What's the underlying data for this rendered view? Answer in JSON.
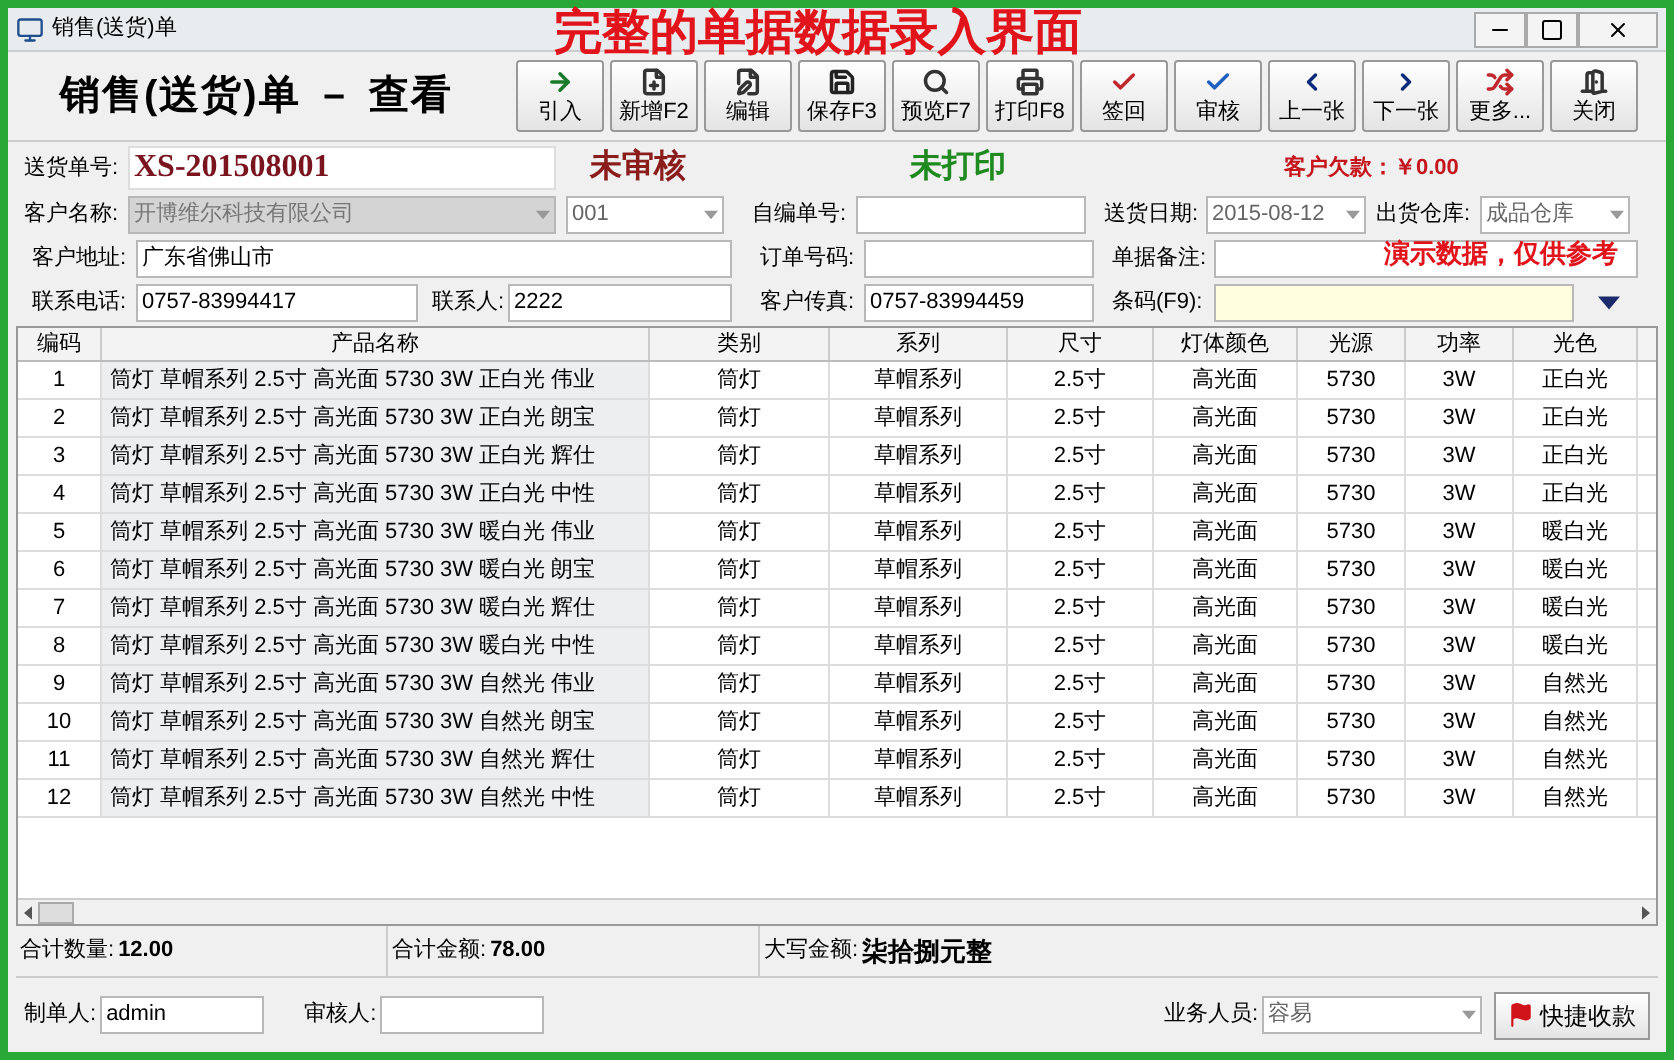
{
  "window": {
    "title": "销售(送货)单"
  },
  "banner": "完整的单据数据录入界面",
  "header": {
    "title": "销售(送货)单 － 查看"
  },
  "toolbar": [
    {
      "label": "引入",
      "kind": "import"
    },
    {
      "label": "新增F2",
      "kind": "new"
    },
    {
      "label": "编辑",
      "kind": "edit"
    },
    {
      "label": "保存F3",
      "kind": "save"
    },
    {
      "label": "预览F7",
      "kind": "preview"
    },
    {
      "label": "打印F8",
      "kind": "print"
    },
    {
      "label": "签回",
      "kind": "signback"
    },
    {
      "label": "审核",
      "kind": "approve"
    },
    {
      "label": "上一张",
      "kind": "prev"
    },
    {
      "label": "下一张",
      "kind": "next"
    },
    {
      "label": "更多...",
      "kind": "more"
    },
    {
      "label": "关闭",
      "kind": "close"
    }
  ],
  "order": {
    "label": "送货单号:",
    "value": "XS-201508001",
    "audit_status": "未审核",
    "print_status": "未打印",
    "debt": "客户欠款：￥0.00"
  },
  "form_rows": [
    [
      {
        "label": "客户名称:",
        "value": "开博维尔科技有限公司",
        "kind": "select",
        "disabled": true
      },
      {
        "value": "001",
        "kind": "select",
        "disabled": false
      },
      {
        "label": "自编单号:",
        "kind": "text"
      },
      {
        "label": "送货日期:",
        "value": "2015-08-12",
        "kind": "select",
        "disabled": false
      },
      {
        "label": "出货仓库:",
        "value": "成品仓库",
        "kind": "select",
        "disabled": false
      }
    ],
    [
      {
        "label": "客户地址:",
        "value": "广东省佛山市",
        "kind": "text"
      },
      {
        "label": "订单号码:",
        "kind": "text"
      },
      {
        "label": "单据备注:",
        "kind": "text"
      }
    ],
    [
      {
        "label": "联系电话:",
        "value": "0757-83994417",
        "kind": "text"
      },
      {
        "label": "联系人:",
        "value": "2222",
        "kind": "text"
      },
      {
        "label": "客户传真:",
        "value": "0757-83994459",
        "kind": "text"
      },
      {
        "label": "条码(F9):",
        "kind": "barcode"
      }
    ]
  ],
  "demo_note": "演示数据，仅供参考",
  "table": {
    "columns": [
      "编码",
      "产品名称",
      "类别",
      "系列",
      "尺寸",
      "灯体颜色",
      "光源",
      "功率",
      "光色"
    ],
    "rows": [
      [
        "1",
        "筒灯 草帽系列 2.5寸 高光面 5730 3W 正白光 伟业",
        "筒灯",
        "草帽系列",
        "2.5寸",
        "高光面",
        "5730",
        "3W",
        "正白光"
      ],
      [
        "2",
        "筒灯 草帽系列 2.5寸 高光面 5730 3W 正白光 朗宝",
        "筒灯",
        "草帽系列",
        "2.5寸",
        "高光面",
        "5730",
        "3W",
        "正白光"
      ],
      [
        "3",
        "筒灯 草帽系列 2.5寸 高光面 5730 3W 正白光 辉仕",
        "筒灯",
        "草帽系列",
        "2.5寸",
        "高光面",
        "5730",
        "3W",
        "正白光"
      ],
      [
        "4",
        "筒灯 草帽系列 2.5寸 高光面 5730 3W 正白光 中性",
        "筒灯",
        "草帽系列",
        "2.5寸",
        "高光面",
        "5730",
        "3W",
        "正白光"
      ],
      [
        "5",
        "筒灯 草帽系列 2.5寸 高光面 5730 3W 暖白光 伟业",
        "筒灯",
        "草帽系列",
        "2.5寸",
        "高光面",
        "5730",
        "3W",
        "暖白光"
      ],
      [
        "6",
        "筒灯 草帽系列 2.5寸 高光面 5730 3W 暖白光 朗宝",
        "筒灯",
        "草帽系列",
        "2.5寸",
        "高光面",
        "5730",
        "3W",
        "暖白光"
      ],
      [
        "7",
        "筒灯 草帽系列 2.5寸 高光面 5730 3W 暖白光 辉仕",
        "筒灯",
        "草帽系列",
        "2.5寸",
        "高光面",
        "5730",
        "3W",
        "暖白光"
      ],
      [
        "8",
        "筒灯 草帽系列 2.5寸 高光面 5730 3W 暖白光 中性",
        "筒灯",
        "草帽系列",
        "2.5寸",
        "高光面",
        "5730",
        "3W",
        "暖白光"
      ],
      [
        "9",
        "筒灯 草帽系列 2.5寸 高光面 5730 3W 自然光 伟业",
        "筒灯",
        "草帽系列",
        "2.5寸",
        "高光面",
        "5730",
        "3W",
        "自然光"
      ],
      [
        "10",
        "筒灯 草帽系列 2.5寸 高光面 5730 3W 自然光 朗宝",
        "筒灯",
        "草帽系列",
        "2.5寸",
        "高光面",
        "5730",
        "3W",
        "自然光"
      ],
      [
        "11",
        "筒灯 草帽系列 2.5寸 高光面 5730 3W 自然光 辉仕",
        "筒灯",
        "草帽系列",
        "2.5寸",
        "高光面",
        "5730",
        "3W",
        "自然光"
      ],
      [
        "12",
        "筒灯 草帽系列 2.5寸 高光面 5730 3W 自然光 中性",
        "筒灯",
        "草帽系列",
        "2.5寸",
        "高光面",
        "5730",
        "3W",
        "自然光"
      ]
    ]
  },
  "totals": [
    {
      "label": "合计数量:",
      "value": "12.00"
    },
    {
      "label": "合计金额:",
      "value": "78.00"
    },
    {
      "label": "大写金额:",
      "value": "柒拾捌元整"
    }
  ],
  "footer": {
    "maker": {
      "label": "制单人:",
      "value": "admin"
    },
    "reviewer": {
      "label": "审核人:"
    },
    "salesperson": {
      "label": "业务人员:",
      "value": "容易"
    },
    "button": "快捷收款"
  }
}
